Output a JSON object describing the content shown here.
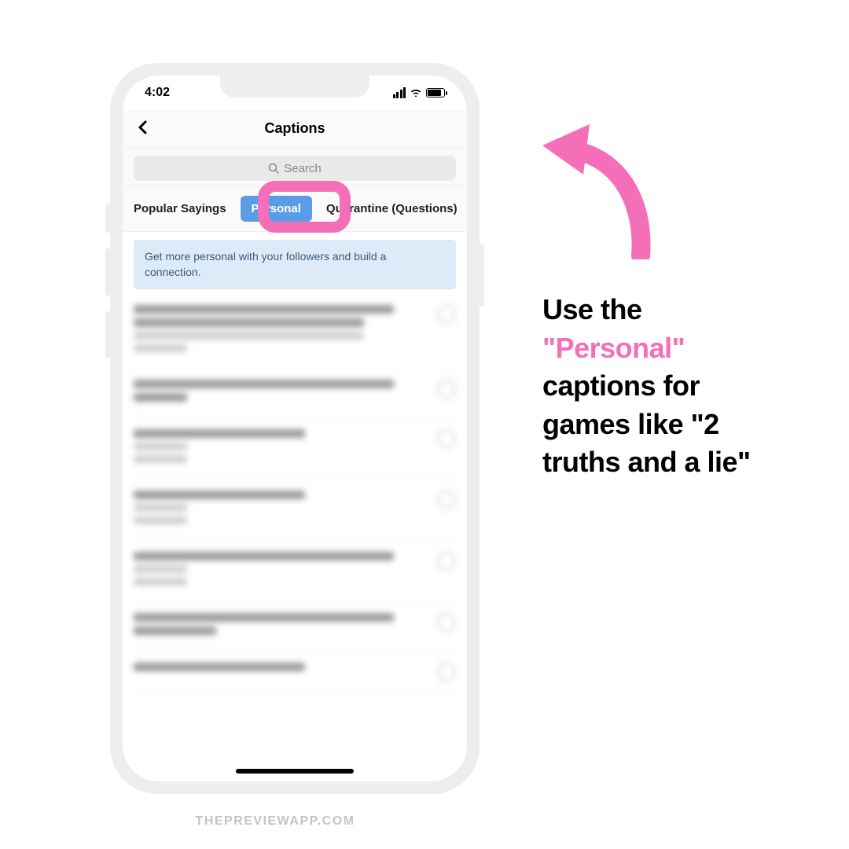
{
  "statusBar": {
    "time": "4:02"
  },
  "header": {
    "title": "Captions"
  },
  "search": {
    "placeholder": "Search"
  },
  "tabs": {
    "left": "Popular Sayings",
    "active": "Personal",
    "right": "Quarantine (Questions)"
  },
  "banner": "Get more personal with your followers and build a connection.",
  "annotation": {
    "line1": "Use the ",
    "highlight": "\"Personal\"",
    "rest": " captions for games like \"2 truths and a lie\""
  },
  "watermark": "THEPREVIEWAPP.COM",
  "colors": {
    "pink": "#f56fb8",
    "blue": "#5a9de6",
    "bannerBg": "#ddebf8"
  }
}
